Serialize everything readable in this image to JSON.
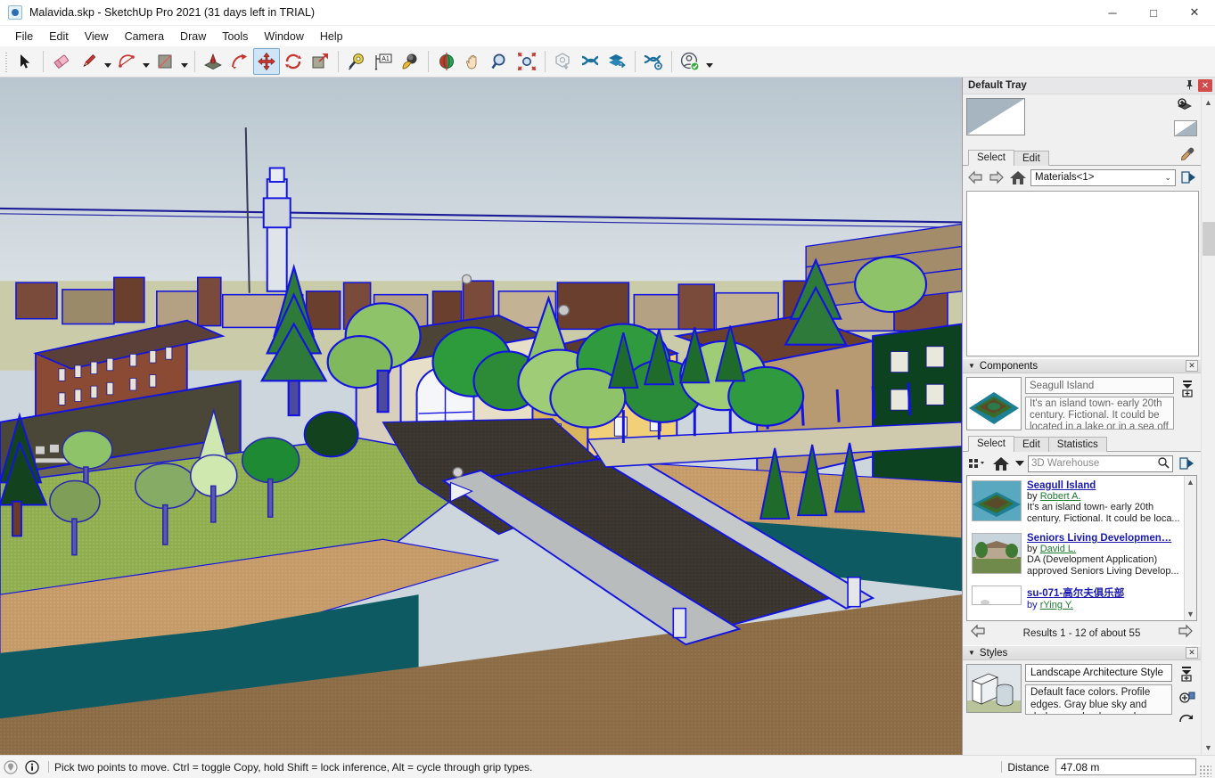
{
  "window": {
    "title": "Malavida.skp - SketchUp Pro 2021 (31 days left in TRIAL)",
    "app_icon": "sketchup-logo-icon",
    "minimize": "─",
    "maximize": "□",
    "close": "✕"
  },
  "menubar": {
    "items": [
      {
        "label": "File"
      },
      {
        "label": "Edit"
      },
      {
        "label": "View"
      },
      {
        "label": "Camera"
      },
      {
        "label": "Draw"
      },
      {
        "label": "Tools"
      },
      {
        "label": "Window"
      },
      {
        "label": "Help"
      }
    ]
  },
  "toolbar": {
    "tools": [
      {
        "name": "select-tool",
        "icon": "cursor-arrow-icon",
        "active": false
      },
      {
        "name": "eraser-tool",
        "icon": "eraser-icon",
        "active": false
      },
      {
        "name": "line-tool",
        "icon": "pencil-icon",
        "active": false,
        "dropdown": true
      },
      {
        "name": "arc-tool",
        "icon": "arc-icon",
        "active": false,
        "dropdown": true
      },
      {
        "name": "rectangle-tool",
        "icon": "rectangle-icon",
        "active": false,
        "dropdown": true
      },
      {
        "name": "pushpull-tool",
        "icon": "push-pull-icon",
        "active": false
      },
      {
        "name": "followme-tool",
        "icon": "follow-me-icon",
        "active": false
      },
      {
        "name": "move-tool",
        "icon": "move-icon",
        "active": true
      },
      {
        "name": "rotate-tool",
        "icon": "rotate-icon",
        "active": false
      },
      {
        "name": "scale-tool",
        "icon": "scale-icon",
        "active": false
      },
      {
        "name": "tape-measure-tool",
        "icon": "tape-measure-icon",
        "active": false
      },
      {
        "name": "text-tool",
        "icon": "text-label-icon",
        "active": false
      },
      {
        "name": "paint-bucket-tool",
        "icon": "paint-bucket-icon",
        "active": false
      },
      {
        "name": "orbit-tool",
        "icon": "orbit-icon",
        "active": false
      },
      {
        "name": "pan-tool",
        "icon": "hand-pan-icon",
        "active": false
      },
      {
        "name": "zoom-tool",
        "icon": "magnifier-icon",
        "active": false
      },
      {
        "name": "zoom-extents-tool",
        "icon": "zoom-extents-icon",
        "active": false
      },
      {
        "name": "3d-warehouse-model-button",
        "icon": "warehouse-model-icon",
        "active": false
      },
      {
        "name": "trimble-connect-button",
        "icon": "trimble-connect-icon",
        "active": false
      },
      {
        "name": "share-model-button",
        "icon": "share-layers-icon",
        "active": false
      },
      {
        "name": "manage-extensions-button",
        "icon": "extension-gear-icon",
        "active": false
      },
      {
        "name": "user-account-button",
        "icon": "user-account-icon",
        "active": false,
        "dropdown": true
      }
    ]
  },
  "tray": {
    "title": "Default Tray",
    "pin_icon": "pin-icon",
    "close_icon": "✕",
    "materials": {
      "tabs": [
        {
          "label": "Select",
          "selected": true
        },
        {
          "label": "Edit",
          "selected": false
        }
      ],
      "eyedropper_icon": "eyedropper-icon",
      "create_material_icon": "create-material-icon",
      "swatch_preview_icon": "material-swatch-icon",
      "display_icon": "display-secondary-icon",
      "back_icon": "⇦",
      "forward_icon": "⇨",
      "home_icon": "home-icon",
      "collection": "Materials<1>",
      "chevron": "⌄",
      "details_icon": "details-arrow-icon"
    },
    "components": {
      "panel_title": "Components",
      "collapse_icon": "▼",
      "close_icon": "✕",
      "selected_name": "Seagull Island",
      "selected_description": "It's an island town- early 20th century. Fictional. It could be located in a lake or in a sea off the shores of New or optional...",
      "stack_icon": "component-stack-icon",
      "tabs": [
        {
          "label": "Select",
          "selected": true
        },
        {
          "label": "Edit",
          "selected": false
        },
        {
          "label": "Statistics",
          "selected": false
        }
      ],
      "view_options_icon": "view-options-icon",
      "nav_home_icon": "home-icon",
      "nav_chevron": "▼",
      "search_placeholder": "3D Warehouse",
      "search_icon": "magnifier-icon",
      "details_icon": "details-arrow-icon",
      "results": [
        {
          "title": "Seagull Island",
          "by_label": "by",
          "author": "Robert A.",
          "description": "It's an island town- early 20th century. Fictional. It could be loca...",
          "thumb": "island-thumbnail"
        },
        {
          "title": "Seniors Living Developmen…",
          "by_label": "by",
          "author": "David L.",
          "description": "DA (Development Application) approved Seniors Living Develop...",
          "thumb": "seniors-living-thumbnail"
        },
        {
          "title": "su-071-高尔夫俱乐部",
          "by_label": "by",
          "author": "rYing Y.",
          "description": "",
          "thumb": "golf-club-thumbnail"
        }
      ],
      "results_count": "Results 1 - 12 of about 55",
      "prev_icon": "⇦",
      "next_icon": "⇨"
    },
    "styles": {
      "panel_title": "Styles",
      "collapse_icon": "▼",
      "close_icon": "✕",
      "name": "Landscape Architecture Style",
      "description": "Default face colors. Profile edges. Gray blue sky and dark green background.",
      "thumb": "style-preview-icon",
      "stack_icon": "style-stack-icon",
      "create_style_icon": "create-style-icon",
      "update_style_icon": "update-style-icon"
    }
  },
  "statusbar": {
    "geo_icon": "geo-location-icon",
    "info_icon": "info-icon",
    "message": "Pick two points to move.  Ctrl = toggle Copy, hold Shift = lock inference, Alt = cycle through grip types.",
    "measurement_label": "Distance",
    "measurement_value": "47.08 m",
    "resize_grip_icon": "resize-grip-icon"
  },
  "viewport": {
    "name": "3d-model-viewport",
    "model": "Seagull Island town scene",
    "colors": {
      "sky_top": "#b9c6cf",
      "sky_bottom": "#e4e9ed",
      "selection_blue": "#1414e0",
      "water": "#0e5a63",
      "sand": "#c79a6b",
      "dirt": "#8a6b46",
      "grass": "#8faf4f",
      "road": "#3b3530",
      "building_yellow": "#f2d07a",
      "building_brown": "#6b3f2e",
      "building_green": "#0d4220",
      "tree_dark": "#147a2a",
      "tree_light": "#9fd07a",
      "concrete": "#b9bcbd"
    }
  }
}
